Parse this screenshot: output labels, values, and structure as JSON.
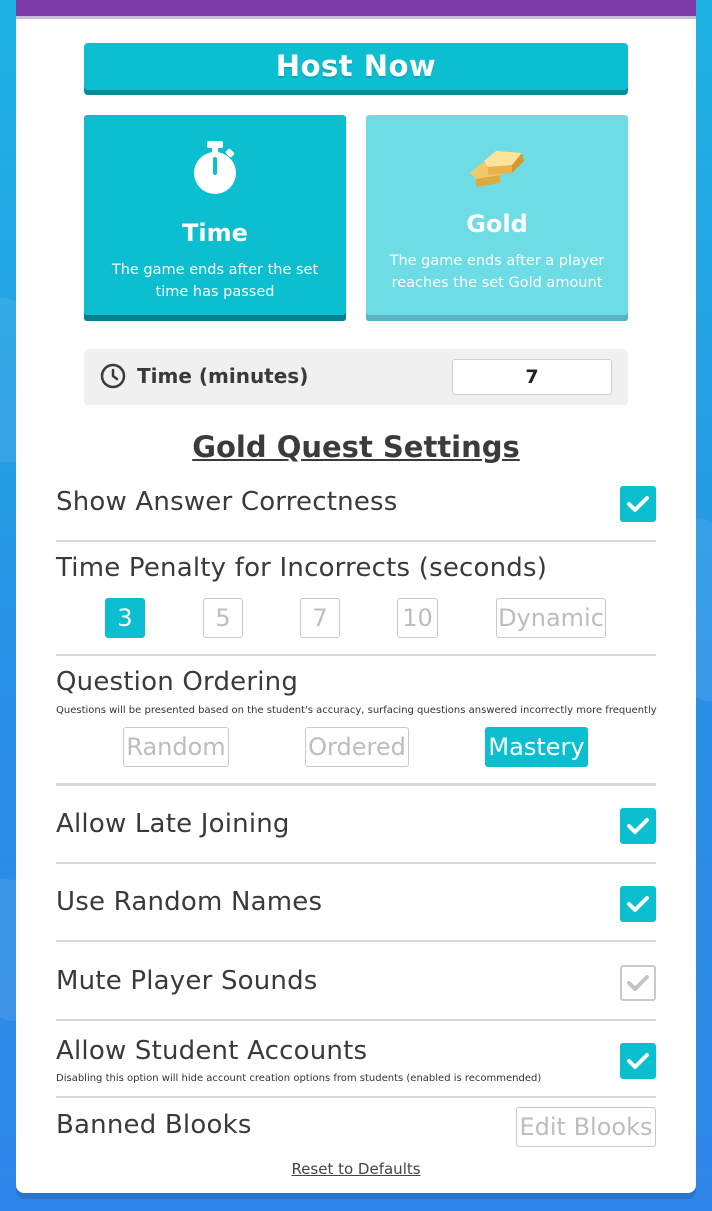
{
  "host_button": "Host Now",
  "modes": [
    {
      "title": "Time",
      "description": "The game ends after the set time has passed",
      "icon": "stopwatch-icon",
      "selected": true
    },
    {
      "title": "Gold",
      "description": "The game ends after a player reaches the set Gold amount",
      "icon": "gold-bars-icon",
      "selected": false
    }
  ],
  "time_setting": {
    "label": "Time (minutes)",
    "value": "7",
    "icon": "clock-icon"
  },
  "settings_title": "Gold Quest Settings",
  "show_answer": {
    "label": "Show Answer Correctness",
    "checked": true
  },
  "penalty": {
    "label": "Time Penalty for Incorrects (seconds)",
    "options": [
      "3",
      "5",
      "7",
      "10",
      "Dynamic"
    ],
    "selected": "3"
  },
  "ordering": {
    "label": "Question Ordering",
    "note": "Questions will be presented based on the student's accuracy, surfacing questions answered incorrectly more frequently",
    "options": [
      "Random",
      "Ordered",
      "Mastery"
    ],
    "selected": "Mastery"
  },
  "late_joining": {
    "label": "Allow Late Joining",
    "checked": true
  },
  "random_names": {
    "label": "Use Random Names",
    "checked": true
  },
  "mute_sounds": {
    "label": "Mute Player Sounds",
    "checked": false
  },
  "student_accounts": {
    "label": "Allow Student Accounts",
    "note": "Disabling this option will hide account creation options from students (enabled is recommended)",
    "checked": true
  },
  "banned_blooks": {
    "label": "Banned Blooks",
    "button": "Edit Blooks"
  },
  "reset_link": "Reset to Defaults",
  "colors": {
    "accent": "#0bbfd1",
    "accent_light": "#6ddce5",
    "header": "#7b3aa8",
    "background": "#2a9be6"
  }
}
